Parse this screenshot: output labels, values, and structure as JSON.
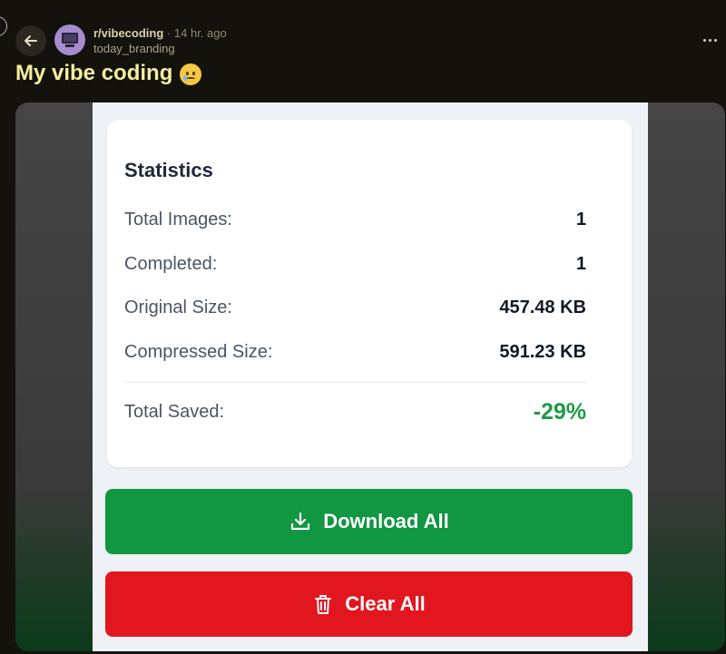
{
  "header": {
    "subreddit": "r/vibecoding",
    "separator": "·",
    "time": "14 hr. ago",
    "username": "today_branding"
  },
  "post": {
    "title": "My vibe coding",
    "title_emoji": "face-holding-back-tears"
  },
  "screenshot": {
    "stats": {
      "title": "Statistics",
      "rows": [
        {
          "label": "Total Images:",
          "value": "1"
        },
        {
          "label": "Completed:",
          "value": "1"
        },
        {
          "label": "Original Size:",
          "value": "457.48 KB"
        },
        {
          "label": "Compressed Size:",
          "value": "591.23 KB"
        }
      ],
      "saved": {
        "label": "Total Saved:",
        "value": "-29%"
      }
    },
    "buttons": {
      "download_label": "Download All",
      "clear_label": "Clear All"
    }
  },
  "colors": {
    "page_bg": "#14120c",
    "title": "#f4eea0",
    "download_green": "#119642",
    "clear_red": "#e2161e",
    "saved_green": "#1f9a48"
  }
}
